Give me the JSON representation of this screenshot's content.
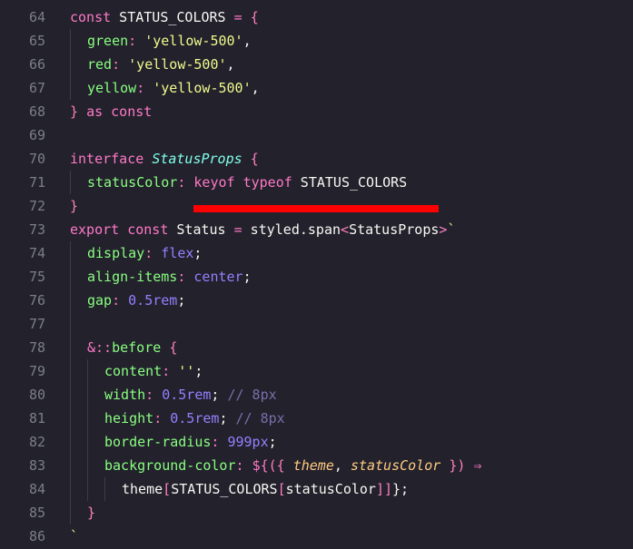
{
  "editor": {
    "lines": [
      {
        "n": "64",
        "indent": 0,
        "tokens": [
          [
            "k",
            "const"
          ],
          [
            "d",
            " STATUS_COLORS "
          ],
          [
            "k",
            "="
          ],
          [
            "d",
            " "
          ],
          [
            "br",
            "{"
          ]
        ]
      },
      {
        "n": "65",
        "indent": 1,
        "tokens": [
          [
            "p",
            "green"
          ],
          [
            "k",
            ":"
          ],
          [
            "d",
            " "
          ],
          [
            "s",
            "'yellow-500'"
          ],
          [
            "d",
            ","
          ]
        ]
      },
      {
        "n": "66",
        "indent": 1,
        "tokens": [
          [
            "p",
            "red"
          ],
          [
            "k",
            ":"
          ],
          [
            "d",
            " "
          ],
          [
            "s",
            "'yellow-500'"
          ],
          [
            "d",
            ","
          ]
        ]
      },
      {
        "n": "67",
        "indent": 1,
        "tokens": [
          [
            "p",
            "yellow"
          ],
          [
            "k",
            ":"
          ],
          [
            "d",
            " "
          ],
          [
            "s",
            "'yellow-500'"
          ],
          [
            "d",
            ","
          ]
        ]
      },
      {
        "n": "68",
        "indent": 0,
        "tokens": [
          [
            "br",
            "}"
          ],
          [
            "d",
            " "
          ],
          [
            "k",
            "as const"
          ]
        ]
      },
      {
        "n": "69",
        "indent": 0,
        "tokens": []
      },
      {
        "n": "70",
        "indent": 0,
        "tokens": [
          [
            "k",
            "interface"
          ],
          [
            "d",
            " "
          ],
          [
            "t",
            "StatusProps"
          ],
          [
            "d",
            " "
          ],
          [
            "br",
            "{"
          ]
        ]
      },
      {
        "n": "71",
        "indent": 1,
        "tokens": [
          [
            "p",
            "statusColor"
          ],
          [
            "k",
            ":"
          ],
          [
            "d",
            " "
          ],
          [
            "k",
            "keyof"
          ],
          [
            "d",
            " "
          ],
          [
            "k",
            "typeof"
          ],
          [
            "d",
            " STATUS_COLORS"
          ]
        ]
      },
      {
        "n": "72",
        "indent": 0,
        "tokens": [
          [
            "br",
            "}"
          ]
        ]
      },
      {
        "n": "73",
        "indent": 0,
        "tokens": [
          [
            "k",
            "export const"
          ],
          [
            "d",
            " Status "
          ],
          [
            "k",
            "="
          ],
          [
            "d",
            " styled.span"
          ],
          [
            "br",
            "<"
          ],
          [
            "d",
            "StatusProps"
          ],
          [
            "br",
            ">"
          ],
          [
            "s",
            "`"
          ]
        ]
      },
      {
        "n": "74",
        "indent": 1,
        "tokens": [
          [
            "p",
            "display"
          ],
          [
            "k",
            ":"
          ],
          [
            "d",
            " "
          ],
          [
            "n",
            "flex"
          ],
          [
            "d",
            ";"
          ]
        ]
      },
      {
        "n": "75",
        "indent": 1,
        "tokens": [
          [
            "p",
            "align-items"
          ],
          [
            "k",
            ":"
          ],
          [
            "d",
            " "
          ],
          [
            "n",
            "center"
          ],
          [
            "d",
            ";"
          ]
        ]
      },
      {
        "n": "76",
        "indent": 1,
        "tokens": [
          [
            "p",
            "gap"
          ],
          [
            "k",
            ":"
          ],
          [
            "d",
            " "
          ],
          [
            "n",
            "0.5rem"
          ],
          [
            "d",
            ";"
          ]
        ]
      },
      {
        "n": "77",
        "indent": 1,
        "tokens": []
      },
      {
        "n": "78",
        "indent": 1,
        "tokens": [
          [
            "k",
            "&"
          ],
          [
            "k",
            "::"
          ],
          [
            "p",
            "before"
          ],
          [
            "d",
            " "
          ],
          [
            "br",
            "{"
          ]
        ]
      },
      {
        "n": "79",
        "indent": 2,
        "tokens": [
          [
            "p",
            "content"
          ],
          [
            "k",
            ":"
          ],
          [
            "d",
            " "
          ],
          [
            "s",
            "''"
          ],
          [
            "d",
            ";"
          ]
        ]
      },
      {
        "n": "80",
        "indent": 2,
        "tokens": [
          [
            "p",
            "width"
          ],
          [
            "k",
            ":"
          ],
          [
            "d",
            " "
          ],
          [
            "n",
            "0.5rem"
          ],
          [
            "d",
            "; "
          ],
          [
            "c",
            "// 8px"
          ]
        ]
      },
      {
        "n": "81",
        "indent": 2,
        "tokens": [
          [
            "p",
            "height"
          ],
          [
            "k",
            ":"
          ],
          [
            "d",
            " "
          ],
          [
            "n",
            "0.5rem"
          ],
          [
            "d",
            "; "
          ],
          [
            "c",
            "// 8px"
          ]
        ]
      },
      {
        "n": "82",
        "indent": 2,
        "tokens": [
          [
            "p",
            "border-radius"
          ],
          [
            "k",
            ":"
          ],
          [
            "d",
            " "
          ],
          [
            "n",
            "999px"
          ],
          [
            "d",
            ";"
          ]
        ]
      },
      {
        "n": "83",
        "indent": 2,
        "tokens": [
          [
            "p",
            "background-color"
          ],
          [
            "k",
            ":"
          ],
          [
            "d",
            " "
          ],
          [
            "k",
            "${"
          ],
          [
            "br",
            "({"
          ],
          [
            "d",
            " "
          ],
          [
            "pr",
            "theme"
          ],
          [
            "d",
            ", "
          ],
          [
            "pr",
            "statusColor"
          ],
          [
            "d",
            " "
          ],
          [
            "br",
            "})"
          ],
          [
            "d",
            " "
          ],
          [
            "k",
            "⇒"
          ]
        ]
      },
      {
        "n": "84",
        "indent": 3,
        "tokens": [
          [
            "d",
            "theme"
          ],
          [
            "br",
            "["
          ],
          [
            "d",
            "STATUS_COLORS"
          ],
          [
            "br",
            "["
          ],
          [
            "d",
            "statusColor"
          ],
          [
            "br",
            "]]"
          ],
          [
            "d",
            "};"
          ]
        ]
      },
      {
        "n": "85",
        "indent": 1,
        "tokens": [
          [
            "br",
            "}"
          ]
        ]
      },
      {
        "n": "86",
        "indent": 0,
        "tokens": [
          [
            "s",
            "`"
          ]
        ]
      }
    ]
  },
  "annotation": {
    "color": "#ff0000",
    "target": "keyof typeof STATUS_COLORS"
  },
  "theme": {
    "background": "#22212c",
    "keyword": "#ff79c6",
    "string": "#f1fa8c",
    "property": "#8aff80",
    "number": "#9580ff",
    "comment": "#7970a9"
  }
}
